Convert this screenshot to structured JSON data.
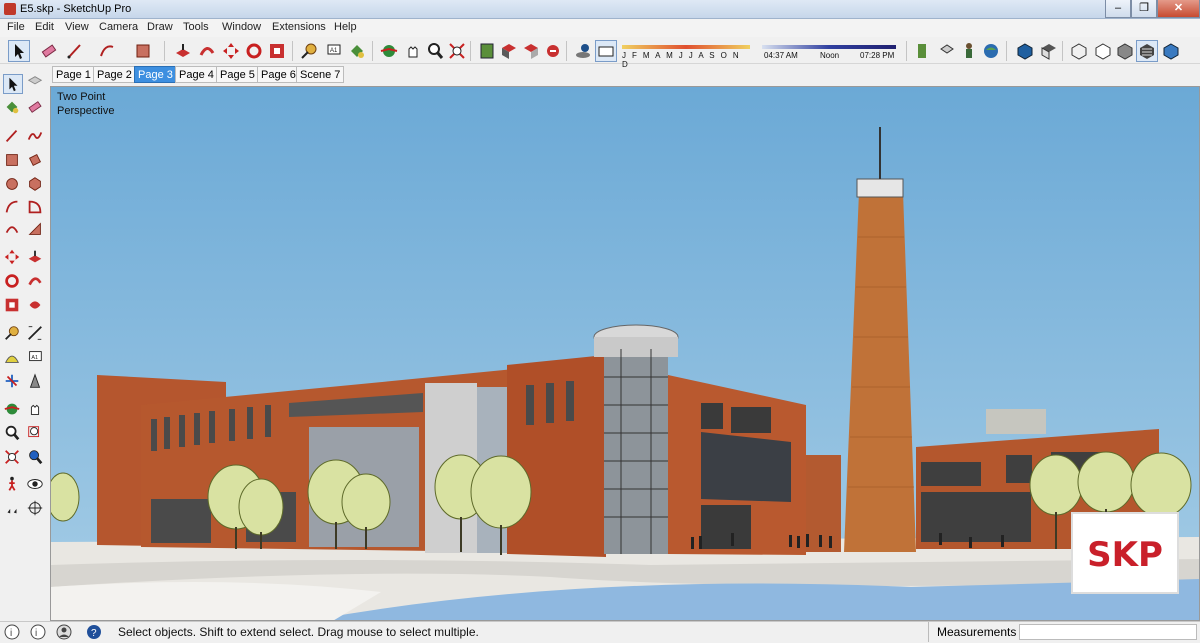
{
  "window": {
    "title": "E5.skp - SketchUp Pro",
    "minimize": "–",
    "maximize": "❐",
    "close": "✕"
  },
  "menu": [
    "File",
    "Edit",
    "View",
    "Camera",
    "Draw",
    "Tools",
    "Window",
    "Extensions",
    "Help"
  ],
  "shadow_settings": {
    "months": "J F M A M J J A S O N D",
    "time_start": "04:37 AM",
    "time_mid": "Noon",
    "time_end": "07:28 PM"
  },
  "scene_tabs": [
    {
      "label": "Page 1",
      "active": false
    },
    {
      "label": "Page 2",
      "active": false
    },
    {
      "label": "Page 3",
      "active": true
    },
    {
      "label": "Page 4",
      "active": false
    },
    {
      "label": "Page 5",
      "active": false
    },
    {
      "label": "Page 6",
      "active": false
    },
    {
      "label": "Scene 7",
      "active": false
    }
  ],
  "viewport": {
    "camera_line1": "Two Point",
    "camera_line2": "Perspective",
    "watermark": "SKP"
  },
  "status": {
    "hint": "Select objects. Shift to extend select. Drag mouse to select multiple.",
    "measurements_label": "Measurements",
    "measurements_value": ""
  },
  "colors": {
    "sky": "#7ab0d6",
    "brick": "#b5562e",
    "tower": "#c07238",
    "tree": "#d9e2a2",
    "accent": "#3d8fe0",
    "badge": "#c9202a"
  },
  "toolbar_icons": [
    "select-icon",
    "eraser-icon",
    "pencil-icon",
    "arc-icon",
    "rectangle-icon",
    "pushpull-icon",
    "followme-icon",
    "move-icon",
    "rotate-icon",
    "scale-icon",
    "offset-icon",
    "tape-icon",
    "text-icon",
    "paint-icon",
    "orbit-icon",
    "pan-icon",
    "zoom-icon",
    "zoom-extents-icon",
    "scene-icon",
    "components-icon",
    "3dwarehouse-icon",
    "shadows-icon",
    "fog-icon",
    "xray-icon",
    "style-icon",
    "iso-view-icon",
    "top-view-icon",
    "front-view-icon",
    "right-view-icon",
    "back-view-icon",
    "left-view-icon"
  ],
  "left_tool_icons": [
    "select-icon",
    "component-icon",
    "paint-bucket-icon",
    "eraser-icon",
    "line-icon",
    "freehand-icon",
    "rectangle-icon",
    "rotated-rect-icon",
    "circle-icon",
    "polygon-icon",
    "arc-icon",
    "pie-icon",
    "move-icon",
    "pushpull-icon",
    "rotate-icon",
    "followme-icon",
    "scale-icon",
    "offset-icon",
    "tape-measure-icon",
    "dimension-icon",
    "protractor-icon",
    "text-icon",
    "axes-icon",
    "3d-text-icon",
    "orbit-icon",
    "pan-icon",
    "zoom-icon",
    "zoom-window-icon",
    "zoom-extents-icon",
    "previous-view-icon",
    "walk-icon",
    "look-around-icon",
    "position-camera-icon",
    "section-plane-icon"
  ]
}
